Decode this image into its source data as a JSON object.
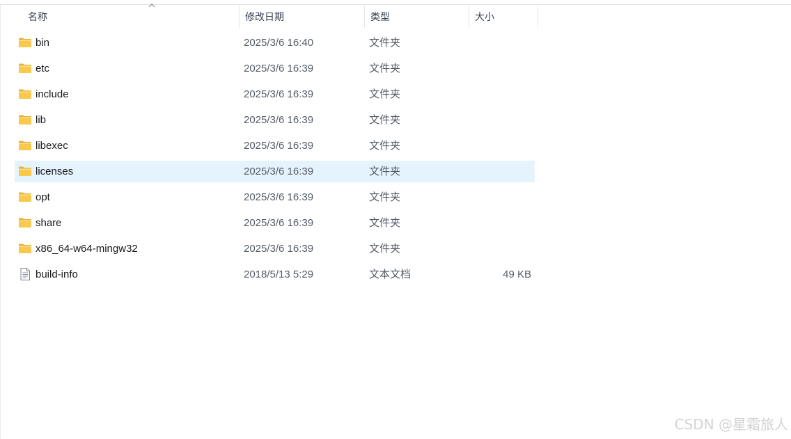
{
  "columns": {
    "name": "名称",
    "date": "修改日期",
    "type": "类型",
    "size": "大小"
  },
  "rows": [
    {
      "name": "bin",
      "date": "2025/3/6 16:40",
      "type": "文件夹",
      "size": "",
      "icon": "folder-icon"
    },
    {
      "name": "etc",
      "date": "2025/3/6 16:39",
      "type": "文件夹",
      "size": "",
      "icon": "folder-icon"
    },
    {
      "name": "include",
      "date": "2025/3/6 16:39",
      "type": "文件夹",
      "size": "",
      "icon": "folder-icon"
    },
    {
      "name": "lib",
      "date": "2025/3/6 16:39",
      "type": "文件夹",
      "size": "",
      "icon": "folder-icon"
    },
    {
      "name": "libexec",
      "date": "2025/3/6 16:39",
      "type": "文件夹",
      "size": "",
      "icon": "folder-icon"
    },
    {
      "name": "licenses",
      "date": "2025/3/6 16:39",
      "type": "文件夹",
      "size": "",
      "icon": "folder-icon",
      "selected": true
    },
    {
      "name": "opt",
      "date": "2025/3/6 16:39",
      "type": "文件夹",
      "size": "",
      "icon": "folder-icon"
    },
    {
      "name": "share",
      "date": "2025/3/6 16:39",
      "type": "文件夹",
      "size": "",
      "icon": "folder-icon"
    },
    {
      "name": "x86_64-w64-mingw32",
      "date": "2025/3/6 16:39",
      "type": "文件夹",
      "size": "",
      "icon": "folder-icon"
    },
    {
      "name": "build-info",
      "date": "2018/5/13 5:29",
      "type": "文本文档",
      "size": "49 KB",
      "icon": "text-file-icon"
    }
  ],
  "watermark": "CSDN @星霜旅人",
  "colors": {
    "folder": "#f8c94b",
    "selected_row": "#e5f3fd",
    "header_text": "#333d4d"
  }
}
